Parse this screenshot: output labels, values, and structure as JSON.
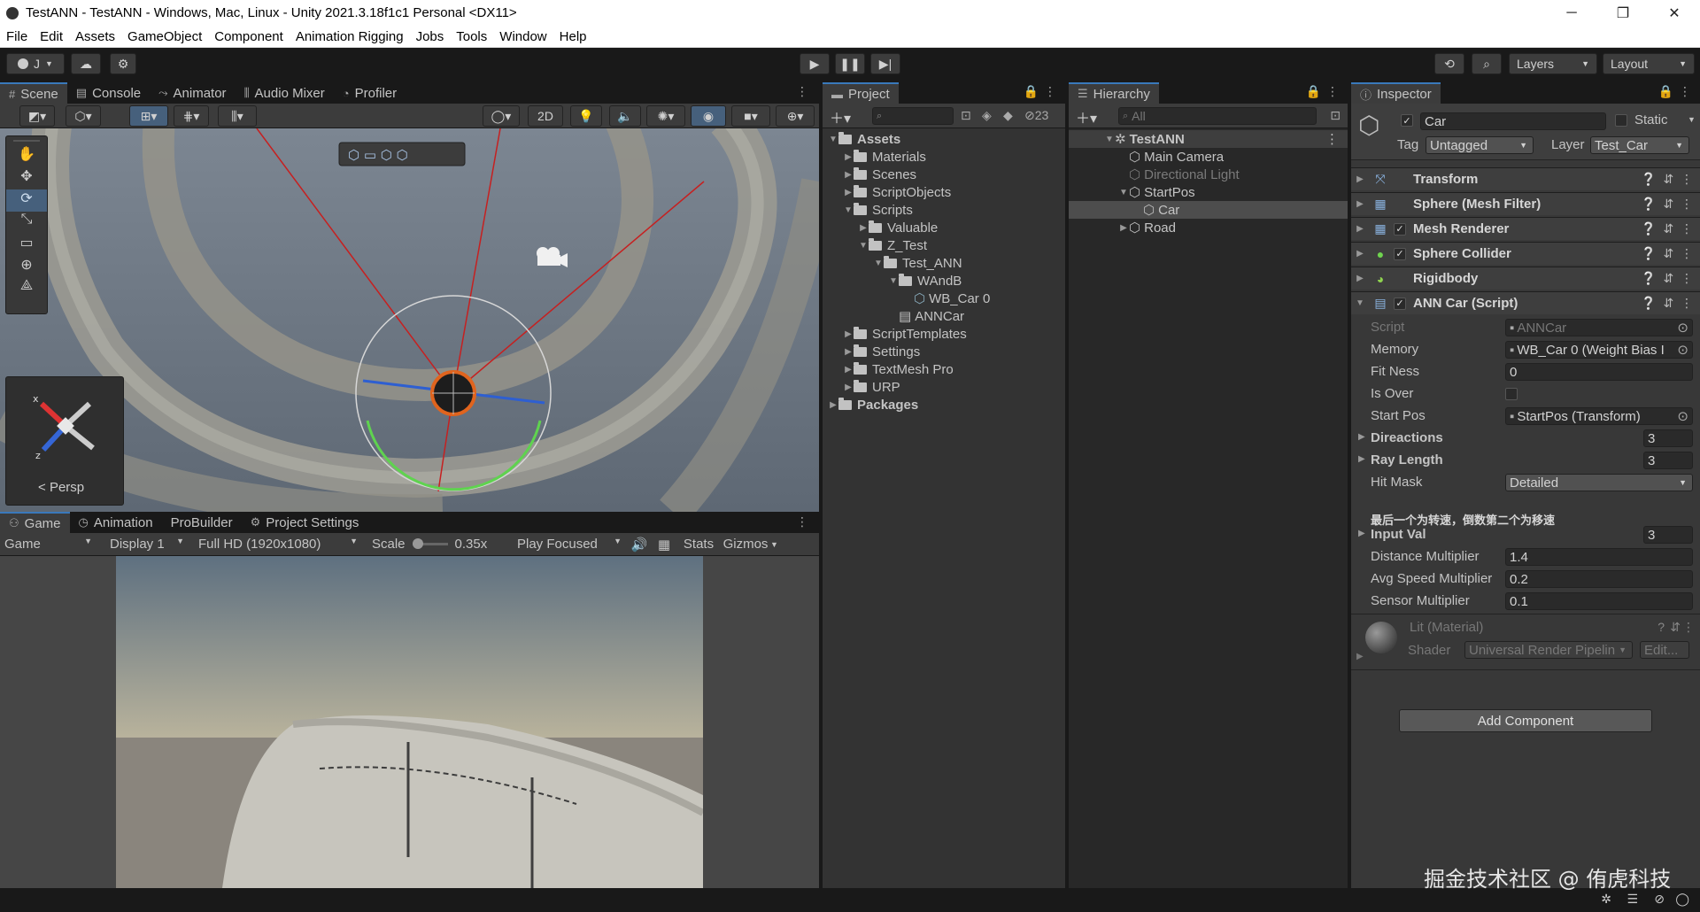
{
  "window": {
    "title": "TestANN - TestANN - Windows, Mac, Linux - Unity 2021.3.18f1c1 Personal <DX11>",
    "min": "─",
    "max": "❐",
    "close": "✕"
  },
  "menu": [
    "File",
    "Edit",
    "Assets",
    "GameObject",
    "Component",
    "Animation Rigging",
    "Jobs",
    "Tools",
    "Window",
    "Help"
  ],
  "toolbar": {
    "account": "J",
    "layers": "Layers",
    "layout": "Layout"
  },
  "scene_panel": {
    "tabs": [
      "Scene",
      "Console",
      "Animator",
      "Audio Mixer",
      "Profiler"
    ],
    "btn_2d": "2D",
    "gizmo_persp": "Persp",
    "count": "23"
  },
  "game_panel": {
    "tabs": [
      "Game",
      "Animation",
      "ProBuilder",
      "Project Settings"
    ],
    "game_select": "Game",
    "display": "Display 1",
    "resolution": "Full HD (1920x1080)",
    "scale_label": "Scale",
    "scale_value": "0.35x",
    "play_mode": "Play Focused",
    "stats": "Stats",
    "gizmos": "Gizmos"
  },
  "project": {
    "tab": "Project",
    "count": "23",
    "tree": [
      {
        "label": "Assets",
        "depth": 0,
        "expanded": true,
        "kind": "folder",
        "bold": true
      },
      {
        "label": "Materials",
        "depth": 1,
        "expanded": false,
        "kind": "folder"
      },
      {
        "label": "Scenes",
        "depth": 1,
        "expanded": false,
        "kind": "folder"
      },
      {
        "label": "ScriptObjects",
        "depth": 1,
        "expanded": false,
        "kind": "folder"
      },
      {
        "label": "Scripts",
        "depth": 1,
        "expanded": true,
        "kind": "folder"
      },
      {
        "label": "Valuable",
        "depth": 2,
        "expanded": false,
        "kind": "folder"
      },
      {
        "label": "Z_Test",
        "depth": 2,
        "expanded": true,
        "kind": "folder"
      },
      {
        "label": "Test_ANN",
        "depth": 3,
        "expanded": true,
        "kind": "folder"
      },
      {
        "label": "WAndB",
        "depth": 4,
        "expanded": true,
        "kind": "folder"
      },
      {
        "label": "WB_Car 0",
        "depth": 5,
        "expanded": null,
        "kind": "asset"
      },
      {
        "label": "ANNCar",
        "depth": 4,
        "expanded": null,
        "kind": "script"
      },
      {
        "label": "ScriptTemplates",
        "depth": 1,
        "expanded": false,
        "kind": "folder"
      },
      {
        "label": "Settings",
        "depth": 1,
        "expanded": false,
        "kind": "folder"
      },
      {
        "label": "TextMesh Pro",
        "depth": 1,
        "expanded": false,
        "kind": "folder"
      },
      {
        "label": "URP",
        "depth": 1,
        "expanded": false,
        "kind": "folder"
      },
      {
        "label": "Packages",
        "depth": 0,
        "expanded": false,
        "kind": "folder",
        "bold": true
      }
    ]
  },
  "hierarchy": {
    "tab": "Hierarchy",
    "search_placeholder": "All",
    "tree": [
      {
        "label": "TestANN",
        "depth": 0,
        "expanded": true,
        "scene": true
      },
      {
        "label": "Main Camera",
        "depth": 1,
        "expanded": null
      },
      {
        "label": "Directional Light",
        "depth": 1,
        "expanded": null,
        "dim": true
      },
      {
        "label": "StartPos",
        "depth": 1,
        "expanded": true
      },
      {
        "label": "Car",
        "depth": 2,
        "expanded": null,
        "selected": true
      },
      {
        "label": "Road",
        "depth": 1,
        "expanded": false
      }
    ]
  },
  "inspector": {
    "tab": "Inspector",
    "object_name": "Car",
    "static_label": "Static",
    "tag_label": "Tag",
    "tag_value": "Untagged",
    "layer_label": "Layer",
    "layer_value": "Test_Car",
    "components": [
      {
        "name": "Transform",
        "checkbox": false,
        "icon": "transform-icon"
      },
      {
        "name": "Sphere (Mesh Filter)",
        "checkbox": false,
        "icon": "mesh-filter-icon"
      },
      {
        "name": "Mesh Renderer",
        "checkbox": true,
        "icon": "mesh-renderer-icon"
      },
      {
        "name": "Sphere Collider",
        "checkbox": true,
        "icon": "sphere-collider-icon"
      },
      {
        "name": "Rigidbody",
        "checkbox": false,
        "icon": "rigidbody-icon"
      },
      {
        "name": "ANN Car (Script)",
        "checkbox": true,
        "icon": "script-icon"
      }
    ],
    "script_fields": [
      {
        "label": "Script",
        "value": "ANNCar",
        "dim": true,
        "obj": true
      },
      {
        "label": "Memory",
        "value": "WB_Car 0 (Weight Bias I",
        "obj": true
      },
      {
        "label": "Fit Ness",
        "value": "0"
      },
      {
        "label": "Is Over",
        "value": "",
        "checkbox": true
      },
      {
        "label": "Start Pos",
        "value": "StartPos (Transform)",
        "obj": true
      },
      {
        "label": "Direactions",
        "value": "3",
        "array": true
      },
      {
        "label": "Ray Length",
        "value": "3",
        "array": true
      },
      {
        "label": "Hit Mask",
        "value": "Detailed",
        "dropdown": true
      }
    ],
    "header_note": "最后一个为转速，倒数第二个为移速",
    "fields2": [
      {
        "label": "Input Val",
        "value": "3",
        "array": true
      },
      {
        "label": "Distance Multiplier",
        "value": "1.4"
      },
      {
        "label": "Avg Speed Multiplier",
        "value": "0.2"
      },
      {
        "label": "Sensor Multiplier",
        "value": "0.1"
      }
    ],
    "material_name": "Lit (Material)",
    "shader_label": "Shader",
    "shader_value": "Universal Render Pipelin",
    "edit_label": "Edit...",
    "add_component": "Add Component"
  },
  "watermark": "掘金技术社区 @ 侑虎科技"
}
